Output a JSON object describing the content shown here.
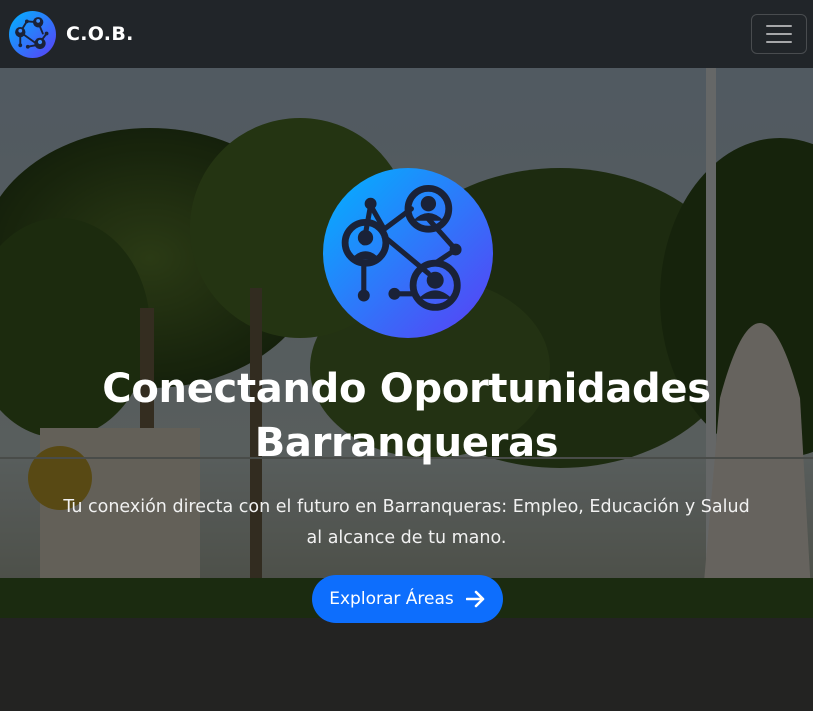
{
  "navbar": {
    "brand_text": "C.O.B.",
    "logo_icon": "network-people-icon",
    "toggle_icon": "hamburger-menu-icon"
  },
  "hero": {
    "logo_icon": "network-people-icon",
    "title": "Conectando Oportunidades Barranqueras",
    "subtitle": "Tu conexión directa con el futuro en Barranqueras: Empleo, Educación y Salud al alcance de tu mano.",
    "cta_label": "Explorar Áreas",
    "cta_icon": "arrow-right-icon",
    "background": "plaza-trees-monument-photo"
  },
  "colors": {
    "navbar_bg": "#212529",
    "accent_blue": "#0d6efd",
    "logo_gradient_start": "#00b4ff",
    "logo_gradient_end": "#5b3df5",
    "logo_lines": "#1a2238",
    "text": "#ffffff"
  }
}
